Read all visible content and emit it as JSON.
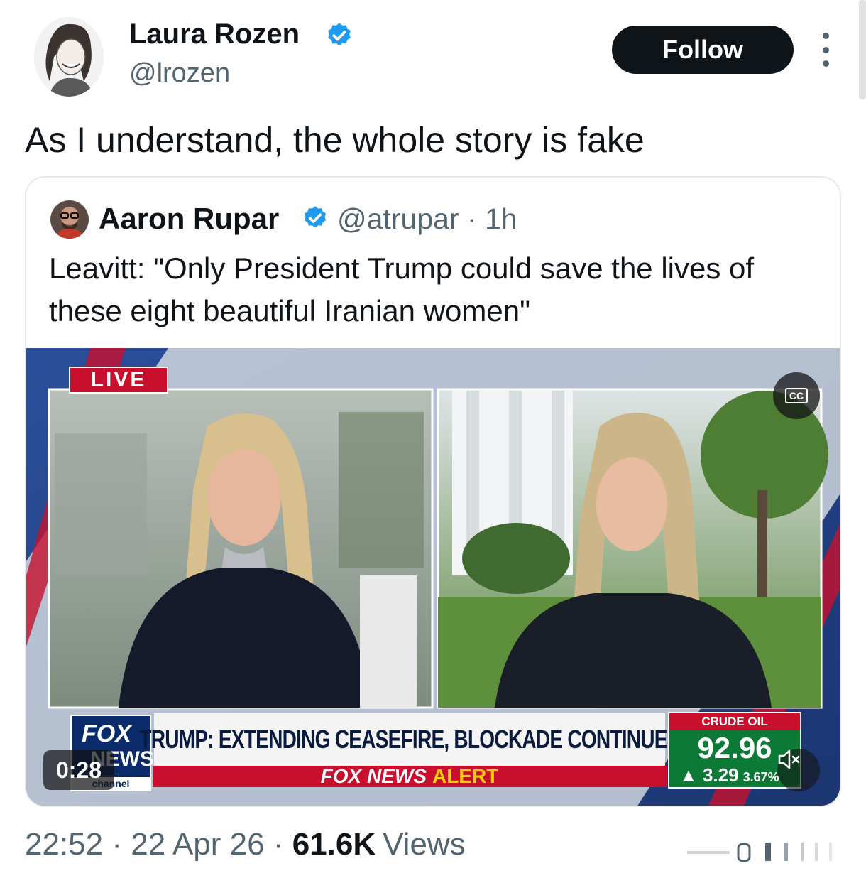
{
  "tweet": {
    "author": {
      "name": "Laura Rozen",
      "handle": "@lrozen",
      "verified": true
    },
    "follow_label": "Follow",
    "text": "As I understand, the whole story is fake",
    "timestamp": "22:52",
    "date": "22 Apr 26",
    "views_count": "61.6K",
    "views_label": "Views"
  },
  "quoted": {
    "author": {
      "name": "Aaron Rupar",
      "handle": "@atrupar",
      "verified": true
    },
    "age": "1h",
    "text": "Leavitt: \"Only President Trump could save the lives of these eight beautiful Iranian women\""
  },
  "video": {
    "live_label": "LIVE",
    "cc_label": "CC",
    "headline": "TRUMP: EXTENDING CEASEFIRE, BLOCKADE CONTINUES",
    "alert_brand": "FOX NEWS",
    "alert_word": "ALERT",
    "logo": {
      "line1": "FOX",
      "line2": "NEWS",
      "line3": "channel"
    },
    "ticker": {
      "label": "CRUDE OIL",
      "value": "92.96",
      "change": "3.29",
      "pct": "3.67%"
    },
    "elapsed": "0:28"
  },
  "colors": {
    "brand_red": "#c8102e",
    "verified_blue": "#1d9bf0",
    "follow_bg": "#0f1419",
    "crude_green": "#0c7a36"
  },
  "icons": [
    "verified-badge-icon",
    "more-options-icon",
    "closed-captions-icon",
    "muted-speaker-icon"
  ]
}
